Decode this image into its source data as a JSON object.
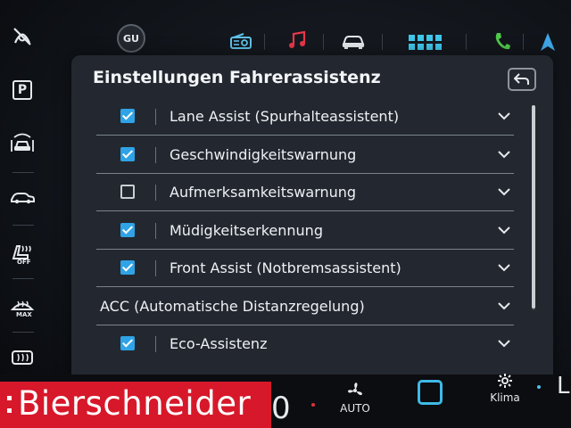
{
  "header": {
    "profile_badge": "GU",
    "icons": [
      "assist-off-icon",
      "radio-icon",
      "music-icon",
      "car-icon",
      "apps-grid-icon",
      "phone-icon",
      "navigation-icon"
    ]
  },
  "left_rail": {
    "parking_label": "P",
    "rear_heat_label": "OFF",
    "defrost_label": "MAX",
    "icons": [
      "assist-off-icon",
      "parking-icon",
      "driver-assist-icon",
      "car-side-icon",
      "seat-heat-off-icon",
      "windshield-defrost-max-icon",
      "rear-defrost-icon"
    ]
  },
  "panel": {
    "title": "Einstellungen Fahrerassistenz",
    "back_icon": "back-arrow-icon",
    "items": [
      {
        "label": "Lane Assist (Spurhalteassistent)",
        "checked": true
      },
      {
        "label": "Geschwindigkeitswarnung",
        "checked": true
      },
      {
        "label": "Aufmerksamkeitswarnung",
        "checked": false
      },
      {
        "label": "Müdigkeitserkennung",
        "checked": true
      },
      {
        "label": "Front Assist (Notbremsassistent)",
        "checked": true
      },
      {
        "label": "ACC (Automatische Distanzregelung)",
        "checked": null
      },
      {
        "label": "Eco-Assistenz",
        "checked": true
      }
    ]
  },
  "bottom": {
    "brand": "Bierschneider",
    "partial_digit": "0",
    "fan_label": "AUTO",
    "climate_label": "Klima",
    "partial_letter": "L"
  },
  "colors": {
    "accent_blue": "#2fa3e6",
    "brand_red": "#d7182a",
    "panel_bg": "#232830",
    "music_red": "#e8374a",
    "phone_green": "#4fc94a",
    "apps_cyan": "#3fc7ea"
  }
}
